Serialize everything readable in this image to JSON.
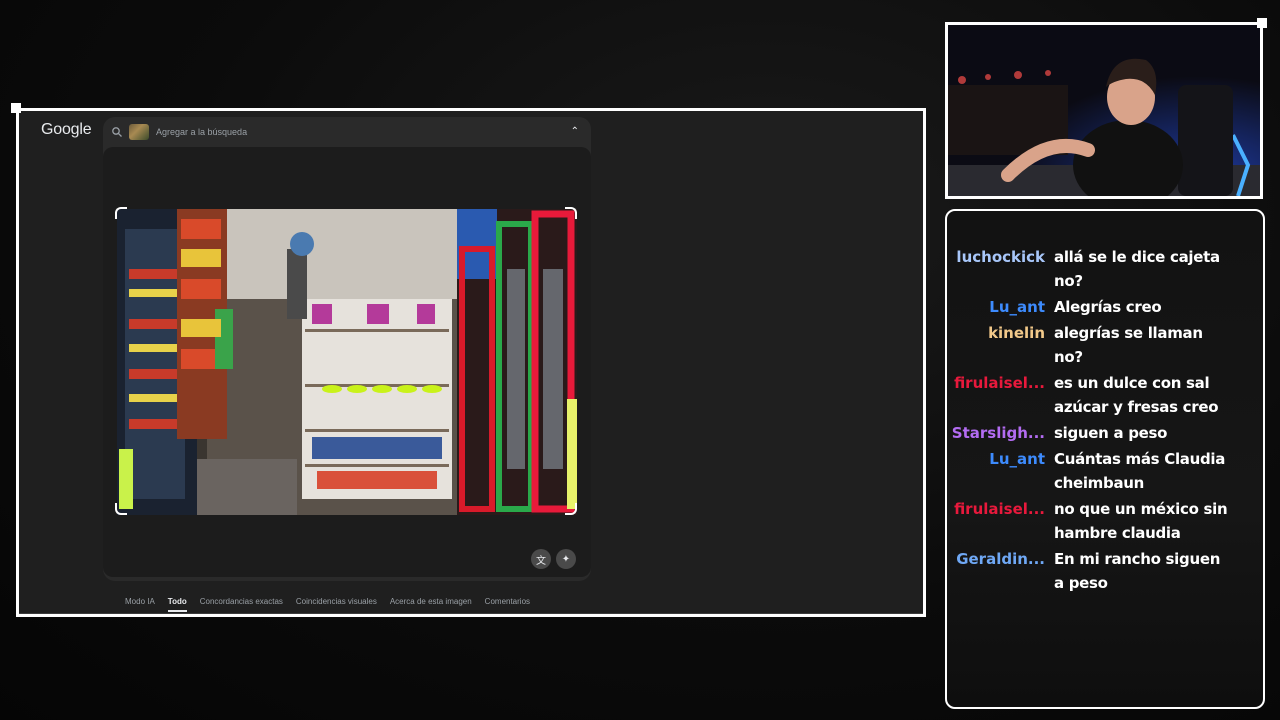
{
  "browser": {
    "logo": "Google",
    "search_placeholder": "Agregar a la búsqueda",
    "tabs": [
      {
        "label": "Modo IA",
        "active": false
      },
      {
        "label": "Todo",
        "active": true
      },
      {
        "label": "Concordancias exactas",
        "active": false
      },
      {
        "label": "Coincidencias visuales",
        "active": false
      },
      {
        "label": "Acerca de esta imagen",
        "active": false
      },
      {
        "label": "Comentarios",
        "active": false
      }
    ]
  },
  "chat": {
    "messages": [
      {
        "user": "luchockick",
        "color": "#a8c7fa",
        "text": "allá se le dice cajeta no?"
      },
      {
        "user": "Lu_ant",
        "color": "#3d8bfd",
        "text": "Alegrías creo"
      },
      {
        "user": "kinelin",
        "color": "#f2c98a",
        "text": "alegrías se llaman no?"
      },
      {
        "user": "firulaisel...",
        "color": "#e8193c",
        "text": "es un dulce con sal azúcar y fresas creo"
      },
      {
        "user": "Starsligh...",
        "color": "#b36cf2",
        "text": "siguen a peso"
      },
      {
        "user": "Lu_ant",
        "color": "#3d8bfd",
        "text": "Cuántas más Claudia cheimbaun"
      },
      {
        "user": "firulaisel...",
        "color": "#e8193c",
        "text": "no que un méxico sin hambre claudia"
      },
      {
        "user": "Geraldin...",
        "color": "#6fa8f5",
        "text": "En mi rancho siguen a peso"
      }
    ]
  }
}
